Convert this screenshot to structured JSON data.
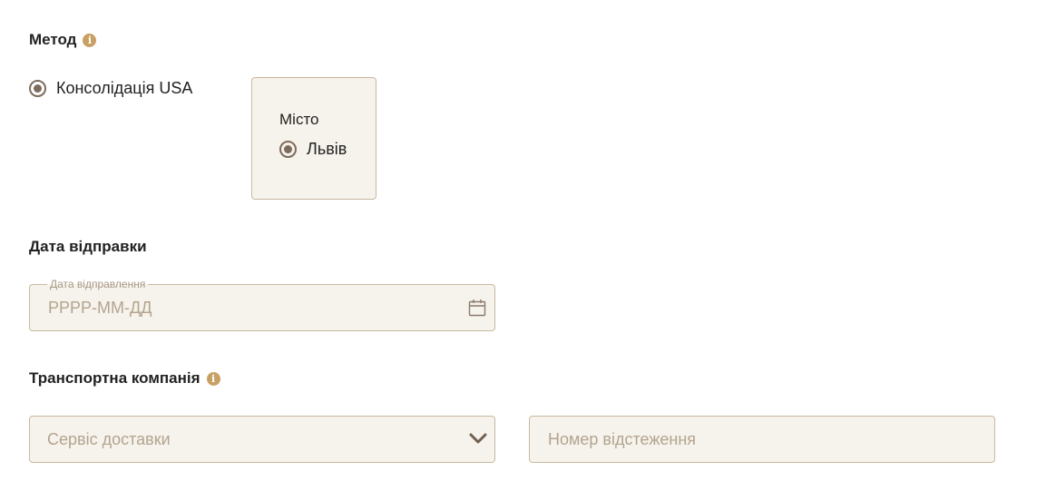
{
  "method": {
    "title": "Метод",
    "info_icon": "info-icon",
    "options": [
      {
        "label": "Консолідація USA",
        "selected": true
      }
    ]
  },
  "city": {
    "title": "Місто",
    "options": [
      {
        "label": "Львів",
        "selected": true
      }
    ]
  },
  "shipping_date": {
    "title": "Дата відправки",
    "field_label": "Дата відправлення",
    "placeholder": "РРРР-ММ-ДД",
    "value": "",
    "icon": "calendar-icon"
  },
  "transport": {
    "title": "Транспортна компанія",
    "info_icon": "info-icon",
    "service_placeholder": "Сервіс доставки",
    "service_icon": "chevron-down-icon",
    "tracking_placeholder": "Номер відстеження"
  },
  "colors": {
    "accent": "#c9a063",
    "radio": "#7d6b5d",
    "field_background": "#f6f3ec",
    "field_border": "#c9b8a0",
    "placeholder": "#b3a48f"
  }
}
